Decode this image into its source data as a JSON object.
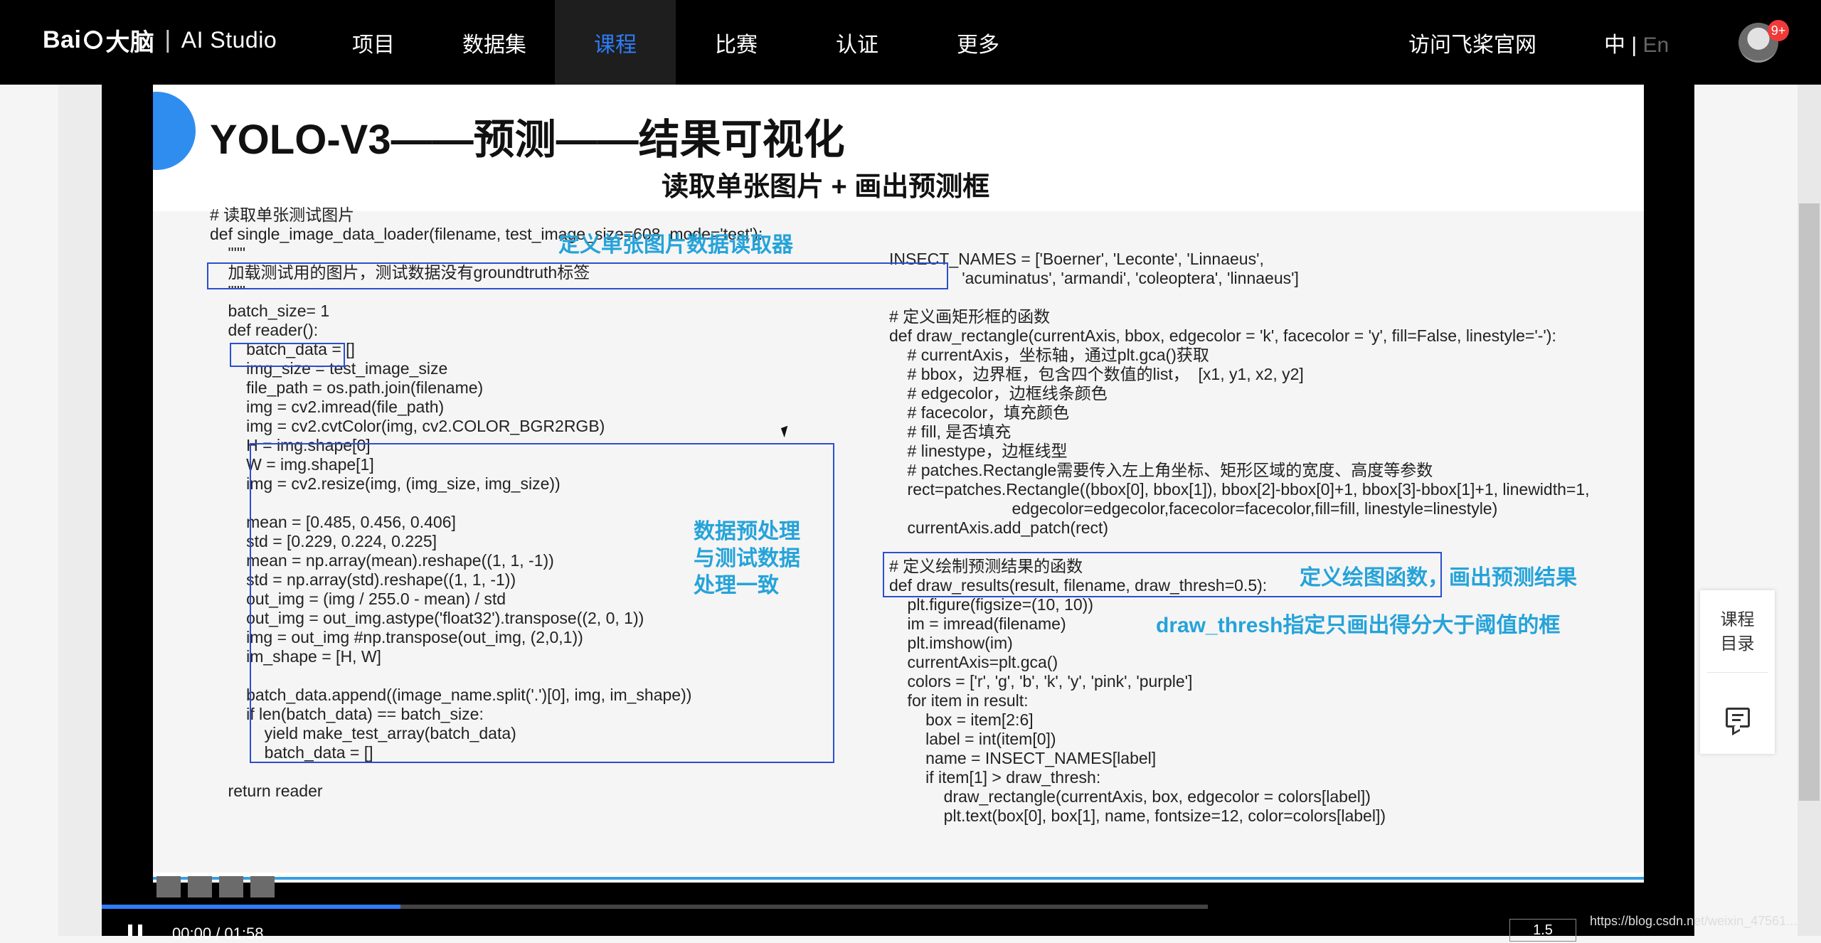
{
  "nav": {
    "logo_brand": "Bai",
    "logo_brand2": "大脑",
    "logo_sep": "|",
    "logo_studio": "AI Studio",
    "items": [
      "项目",
      "数据集",
      "课程",
      "比赛",
      "认证",
      "更多"
    ],
    "active_index": 2,
    "visit": "访问飞桨官网",
    "lang_zh": "中",
    "lang_sep": "|",
    "lang_en": "En",
    "badge": "9+"
  },
  "slide": {
    "title": "YOLO-V3——预测——结果可视化",
    "subtitle": "读取单张图片 + 画出预测框",
    "left_code": "# 读取单张测试图片\ndef single_image_data_loader(filename, test_image_size=608, mode='test'):\n    \"\"\"\n    加载测试用的图片，测试数据没有groundtruth标签\n    \"\"\"\n    batch_size= 1\n    def reader():\n        batch_data = []\n        img_size = test_image_size\n        file_path = os.path.join(filename)\n        img = cv2.imread(file_path)\n        img = cv2.cvtColor(img, cv2.COLOR_BGR2RGB)\n        H = img.shape[0]\n        W = img.shape[1]\n        img = cv2.resize(img, (img_size, img_size))\n\n        mean = [0.485, 0.456, 0.406]\n        std = [0.229, 0.224, 0.225]\n        mean = np.array(mean).reshape((1, 1, -1))\n        std = np.array(std).reshape((1, 1, -1))\n        out_img = (img / 255.0 - mean) / std\n        out_img = out_img.astype('float32').transpose((2, 0, 1))\n        img = out_img #np.transpose(out_img, (2,0,1))\n        im_shape = [H, W]\n\n        batch_data.append((image_name.split('.')[0], img, im_shape))\n        if len(batch_data) == batch_size:\n            yield make_test_array(batch_data)\n            batch_data = []\n\n    return reader",
    "right_code": "INSECT_NAMES = ['Boerner', 'Leconte', 'Linnaeus',\n                'acuminatus', 'armandi', 'coleoptera', 'linnaeus']\n\n# 定义画矩形框的函数\ndef draw_rectangle(currentAxis, bbox, edgecolor = 'k', facecolor = 'y', fill=False, linestyle='-'):\n    # currentAxis，坐标轴，通过plt.gca()获取\n    # bbox，边界框，包含四个数值的list，  [x1, y1, x2, y2]\n    # edgecolor，边框线条颜色\n    # facecolor，填充颜色\n    # fill, 是否填充\n    # linestype，边框线型\n    # patches.Rectangle需要传入左上角坐标、矩形区域的宽度、高度等参数\n    rect=patches.Rectangle((bbox[0], bbox[1]), bbox[2]-bbox[0]+1, bbox[3]-bbox[1]+1, linewidth=1,\n                           edgecolor=edgecolor,facecolor=facecolor,fill=fill, linestyle=linestyle)\n    currentAxis.add_patch(rect)\n\n# 定义绘制预测结果的函数\ndef draw_results(result, filename, draw_thresh=0.5):\n    plt.figure(figsize=(10, 10))\n    im = imread(filename)\n    plt.imshow(im)\n    currentAxis=plt.gca()\n    colors = ['r', 'g', 'b', 'k', 'y', 'pink', 'purple']\n    for item in result:\n        box = item[2:6]\n        label = int(item[0])\n        name = INSECT_NAMES[label]\n        if item[1] > draw_thresh:\n            draw_rectangle(currentAxis, box, edgecolor = colors[label])\n            plt.text(box[0], box[1], name, fontsize=12, color=colors[label])",
    "ann_loader": "定义单张图片数据读取器",
    "ann_preprocess": "数据预处理\n与测试数据\n处理一致",
    "ann_draw_fn": "定义绘图函数，画出预测结果",
    "ann_thresh": "draw_thresh指定只画出得分大于阈值的框"
  },
  "player": {
    "time": "00:00 / 01:58",
    "speed": "1.5",
    "watermark": "https://blog.csdn.net/weixin_47561..."
  },
  "side": {
    "catalog": "课程\n目录"
  },
  "colors": {
    "accent": "#2f7cf6",
    "annotation": "#25a3d9",
    "box": "#2b4fd0",
    "badge": "#f03a3a"
  }
}
